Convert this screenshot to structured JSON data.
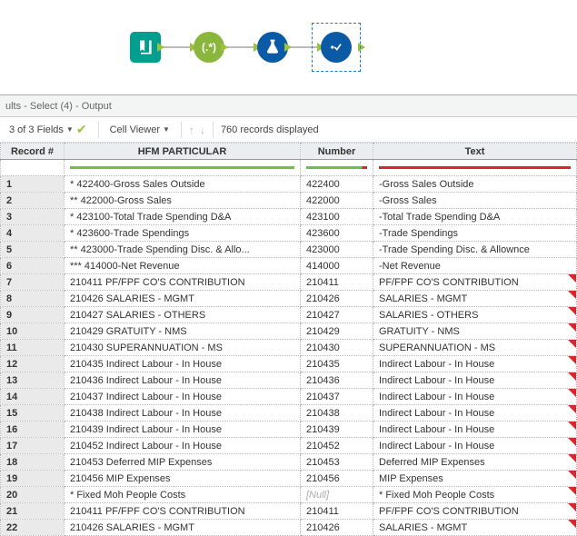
{
  "pane_title": "ults - Select (4) - Output",
  "toolbar": {
    "fields_label": "3 of 3 Fields",
    "cell_viewer_label": "Cell Viewer",
    "records_label": "760 records displayed"
  },
  "columns": {
    "record": "Record #",
    "hfm": "HFM PARTICULAR",
    "number": "Number",
    "text": "Text"
  },
  "rows": [
    {
      "n": "1",
      "hfm": "*            422400-Gross Sales Outside",
      "num": "422400",
      "txt": "-Gross Sales Outside",
      "null_num": false,
      "flag": false
    },
    {
      "n": "2",
      "hfm": "**          422000-Gross Sales",
      "num": "422000",
      "txt": "-Gross Sales",
      "null_num": false,
      "flag": false
    },
    {
      "n": "3",
      "hfm": "*            423100-Total Trade Spending D&A",
      "num": "423100",
      "txt": "-Total Trade Spending D&A",
      "null_num": false,
      "flag": false
    },
    {
      "n": "4",
      "hfm": "*            423600-Trade Spendings",
      "num": "423600",
      "txt": "-Trade Spendings",
      "null_num": false,
      "flag": false
    },
    {
      "n": "5",
      "hfm": "**          423000-Trade Spending Disc. & Allo...",
      "num": "423000",
      "txt": "-Trade Spending Disc. & Allownce",
      "null_num": false,
      "flag": false
    },
    {
      "n": "6",
      "hfm": "***        414000-Net Revenue",
      "num": "414000",
      "txt": "-Net Revenue",
      "null_num": false,
      "flag": false
    },
    {
      "n": "7",
      "hfm": "210411  PF/FPF CO'S CONTRIBUTION",
      "num": "210411",
      "txt": "  PF/FPF CO'S CONTRIBUTION",
      "null_num": false,
      "flag": true
    },
    {
      "n": "8",
      "hfm": "210426  SALARIES - MGMT",
      "num": "210426",
      "txt": "  SALARIES - MGMT",
      "null_num": false,
      "flag": true
    },
    {
      "n": "9",
      "hfm": "210427  SALARIES - OTHERS",
      "num": "210427",
      "txt": "  SALARIES - OTHERS",
      "null_num": false,
      "flag": true
    },
    {
      "n": "10",
      "hfm": "210429  GRATUITY - NMS",
      "num": "210429",
      "txt": "  GRATUITY - NMS",
      "null_num": false,
      "flag": true
    },
    {
      "n": "11",
      "hfm": "210430  SUPERANNUATION - MS",
      "num": "210430",
      "txt": "  SUPERANNUATION - MS",
      "null_num": false,
      "flag": true
    },
    {
      "n": "12",
      "hfm": "210435  Indirect Labour - In House",
      "num": "210435",
      "txt": "  Indirect Labour - In House",
      "null_num": false,
      "flag": true
    },
    {
      "n": "13",
      "hfm": "210436  Indirect Labour - In House",
      "num": "210436",
      "txt": "  Indirect Labour - In House",
      "null_num": false,
      "flag": true
    },
    {
      "n": "14",
      "hfm": "210437  Indirect Labour - In House",
      "num": "210437",
      "txt": "  Indirect Labour - In House",
      "null_num": false,
      "flag": true
    },
    {
      "n": "15",
      "hfm": "210438  Indirect Labour - In House",
      "num": "210438",
      "txt": "  Indirect Labour - In House",
      "null_num": false,
      "flag": true
    },
    {
      "n": "16",
      "hfm": "210439  Indirect Labour - In House",
      "num": "210439",
      "txt": "  Indirect Labour - In House",
      "null_num": false,
      "flag": true
    },
    {
      "n": "17",
      "hfm": "210452  Indirect Labour - In House",
      "num": "210452",
      "txt": "  Indirect Labour - In House",
      "null_num": false,
      "flag": true
    },
    {
      "n": "18",
      "hfm": "210453  Deferred MIP Expenses",
      "num": "210453",
      "txt": "  Deferred MIP Expenses",
      "null_num": false,
      "flag": true
    },
    {
      "n": "19",
      "hfm": "210456  MIP Expenses",
      "num": "210456",
      "txt": "  MIP Expenses",
      "null_num": false,
      "flag": true
    },
    {
      "n": "20",
      "hfm": "*            Fixed Moh People Costs",
      "num": "[Null]",
      "txt": "*            Fixed Moh People Costs",
      "null_num": true,
      "flag": true
    },
    {
      "n": "21",
      "hfm": "210411  PF/FPF CO'S CONTRIBUTION",
      "num": "210411",
      "txt": "  PF/FPF CO'S CONTRIBUTION",
      "null_num": false,
      "flag": true
    },
    {
      "n": "22",
      "hfm": "210426  SALARIES - MGMT",
      "num": "210426",
      "txt": "  SALARIES - MGMT",
      "null_num": false,
      "flag": true
    }
  ]
}
